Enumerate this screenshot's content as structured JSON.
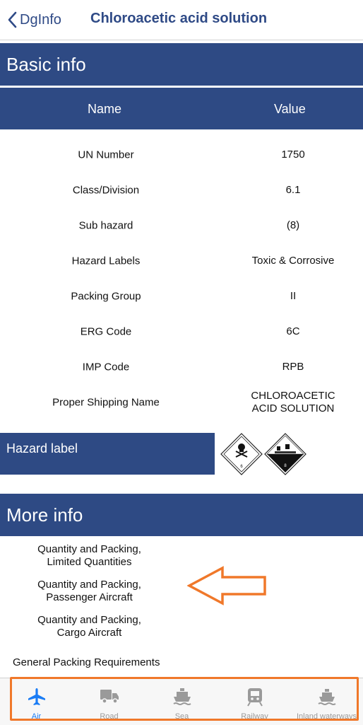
{
  "nav": {
    "back_label": "DgInfo",
    "title": "Chloroacetic acid solution"
  },
  "basic_info": {
    "header": "Basic info",
    "columns": {
      "name": "Name",
      "value": "Value"
    },
    "rows": [
      {
        "name": "UN Number",
        "value": "1750"
      },
      {
        "name": "Class/Division",
        "value": "6.1"
      },
      {
        "name": "Sub hazard",
        "value": "(8)"
      },
      {
        "name": "Hazard Labels",
        "value": "Toxic & Corrosive"
      },
      {
        "name": "Packing Group",
        "value": "II"
      },
      {
        "name": "ERG Code",
        "value": "6C"
      },
      {
        "name": "IMP Code",
        "value": "RPB"
      },
      {
        "name": "Proper Shipping Name",
        "value_line1": "CHLOROACETIC",
        "value_line2": "ACID SOLUTION"
      }
    ]
  },
  "hazard_label": {
    "header": "Hazard label",
    "labels": [
      {
        "icon": "toxic-skull-icon",
        "class_number": "6"
      },
      {
        "icon": "corrosive-icon",
        "class_number": "8"
      }
    ]
  },
  "more_info": {
    "header": "More info",
    "items": [
      {
        "line1": "Quantity and Packing,",
        "line2": "Limited Quantities"
      },
      {
        "line1": "Quantity and Packing,",
        "line2": "Passenger Aircraft"
      },
      {
        "line1": "Quantity and Packing,",
        "line2": "Cargo Aircraft"
      }
    ],
    "general_packing": "General Packing Requirements"
  },
  "tabbar": {
    "active_color": "#1a7cf5",
    "inactive_color": "#9a9a9a",
    "tabs": [
      {
        "label": "Air",
        "icon": "airplane-icon",
        "active": true
      },
      {
        "label": "Road",
        "icon": "truck-icon",
        "active": false
      },
      {
        "label": "Sea",
        "icon": "ship-icon",
        "active": false
      },
      {
        "label": "Railway",
        "icon": "train-icon",
        "active": false
      },
      {
        "label": "Inland waterways",
        "icon": "boat-icon",
        "active": false
      }
    ]
  },
  "colors": {
    "header_bg": "#2e4a84",
    "nav_text": "#2f4a86",
    "annotation_orange": "#f0782a"
  }
}
